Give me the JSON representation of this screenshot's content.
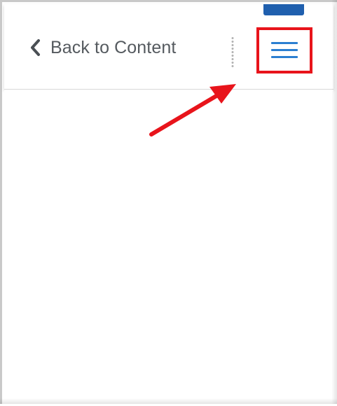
{
  "header": {
    "back_label": "Back to Content",
    "back_icon": "chevron-left-icon",
    "menu_icon": "hamburger-menu-icon"
  },
  "annotation": {
    "highlight_color": "#e8141b",
    "arrow_color": "#e8141b"
  },
  "colors": {
    "accent": "#1f5fae",
    "menu_icon": "#2b7fd1",
    "text": "#555a5f"
  }
}
